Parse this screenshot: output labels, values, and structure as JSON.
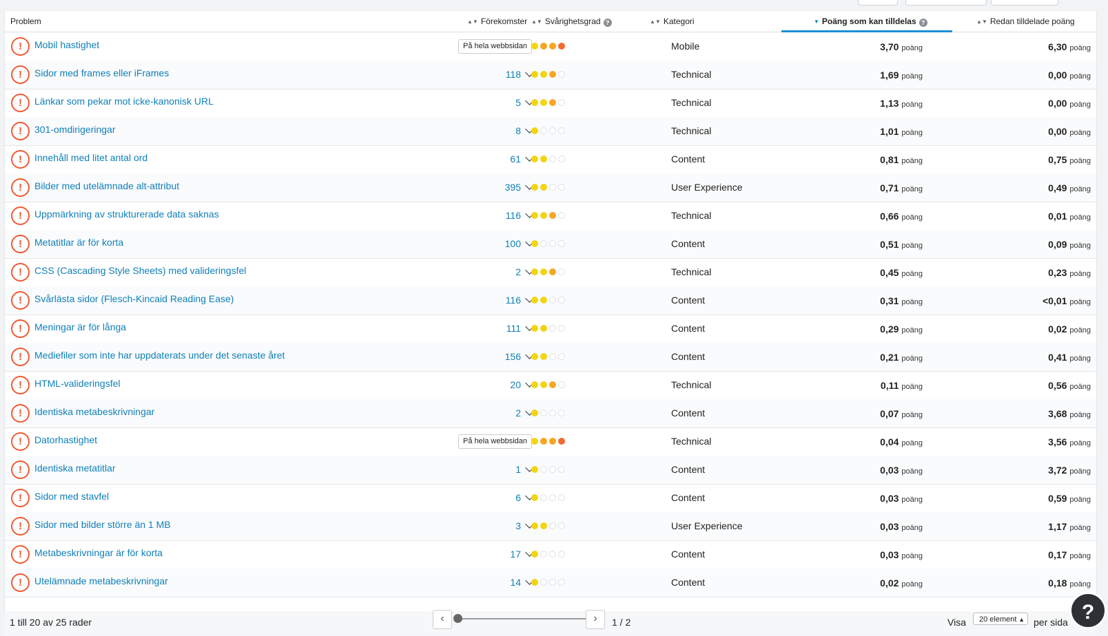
{
  "header": {
    "problem": "Problem",
    "occurrences": "Förekomster",
    "difficulty": "Svårighetsgrad",
    "category": "Kategori",
    "points": "Poäng som kan tilldelas",
    "awarded": "Redan tilldelade poäng",
    "help_glyph": "?"
  },
  "colors": {
    "link": "#0f7fb8",
    "error": "#f05a32",
    "dot_yellow": "#f2d413",
    "dot_amber": "#f6a623",
    "dot_orange": "#f26b2e",
    "dot_empty_border": "#dcdfe3",
    "accent": "#1a8fd6"
  },
  "icons": {
    "row": "exclamation-circle-icon",
    "expand": "chevron-down-icon",
    "sort": "sort-arrows-icon"
  },
  "unit": "poäng",
  "site_label": "På hela webbsidan",
  "rows": [
    {
      "name": "Mobil hastighet",
      "occ": "",
      "site": true,
      "dots": [
        1,
        2,
        2,
        3
      ],
      "cat": "Mobile",
      "pts": "3,70",
      "awarded": "6,30"
    },
    {
      "name": "Sidor med frames eller iFrames",
      "occ": "118",
      "site": false,
      "dots": [
        1,
        1,
        2,
        0
      ],
      "cat": "Technical",
      "pts": "1,69",
      "awarded": "0,00"
    },
    {
      "name": "Länkar som pekar mot icke-kanonisk URL",
      "occ": "5",
      "site": false,
      "dots": [
        1,
        1,
        2,
        0
      ],
      "cat": "Technical",
      "pts": "1,13",
      "awarded": "0,00"
    },
    {
      "name": "301-omdirigeringar",
      "occ": "8",
      "site": false,
      "dots": [
        1,
        0,
        0,
        0
      ],
      "cat": "Technical",
      "pts": "1,01",
      "awarded": "0,00"
    },
    {
      "name": "Innehåll med litet antal ord",
      "occ": "61",
      "site": false,
      "dots": [
        1,
        1,
        0,
        0
      ],
      "cat": "Content",
      "pts": "0,81",
      "awarded": "0,75"
    },
    {
      "name": "Bilder med utelämnade alt-attribut",
      "occ": "395",
      "site": false,
      "dots": [
        1,
        1,
        0,
        0
      ],
      "cat": "User Experience",
      "pts": "0,71",
      "awarded": "0,49"
    },
    {
      "name": "Uppmärkning av strukturerade data saknas",
      "occ": "116",
      "site": false,
      "dots": [
        1,
        1,
        2,
        0
      ],
      "cat": "Technical",
      "pts": "0,66",
      "awarded": "0,01"
    },
    {
      "name": "Metatitlar är för korta",
      "occ": "100",
      "site": false,
      "dots": [
        1,
        0,
        0,
        0
      ],
      "cat": "Content",
      "pts": "0,51",
      "awarded": "0,09"
    },
    {
      "name": "CSS (Cascading Style Sheets) med valideringsfel",
      "occ": "2",
      "site": false,
      "dots": [
        1,
        1,
        2,
        0
      ],
      "cat": "Technical",
      "pts": "0,45",
      "awarded": "0,23"
    },
    {
      "name": "Svårlästa sidor (Flesch-Kincaid Reading Ease)",
      "occ": "116",
      "site": false,
      "dots": [
        1,
        1,
        0,
        0
      ],
      "cat": "Content",
      "pts": "0,31",
      "awarded": "<0,01"
    },
    {
      "name": "Meningar är för långa",
      "occ": "111",
      "site": false,
      "dots": [
        1,
        1,
        0,
        0
      ],
      "cat": "Content",
      "pts": "0,29",
      "awarded": "0,02"
    },
    {
      "name": "Mediefiler som inte har uppdaterats under det senaste året",
      "occ": "156",
      "site": false,
      "dots": [
        1,
        1,
        0,
        0
      ],
      "cat": "Content",
      "pts": "0,21",
      "awarded": "0,41"
    },
    {
      "name": "HTML-valideringsfel",
      "occ": "20",
      "site": false,
      "dots": [
        1,
        1,
        2,
        0
      ],
      "cat": "Technical",
      "pts": "0,11",
      "awarded": "0,56"
    },
    {
      "name": "Identiska metabeskrivningar",
      "occ": "2",
      "site": false,
      "dots": [
        1,
        0,
        0,
        0
      ],
      "cat": "Content",
      "pts": "0,07",
      "awarded": "3,68"
    },
    {
      "name": "Datorhastighet",
      "occ": "",
      "site": true,
      "dots": [
        1,
        2,
        2,
        3
      ],
      "cat": "Technical",
      "pts": "0,04",
      "awarded": "3,56"
    },
    {
      "name": "Identiska metatitlar",
      "occ": "1",
      "site": false,
      "dots": [
        1,
        0,
        0,
        0
      ],
      "cat": "Content",
      "pts": "0,03",
      "awarded": "3,72"
    },
    {
      "name": "Sidor med stavfel",
      "occ": "6",
      "site": false,
      "dots": [
        1,
        0,
        0,
        0
      ],
      "cat": "Content",
      "pts": "0,03",
      "awarded": "0,59"
    },
    {
      "name": "Sidor med bilder större än 1 MB",
      "occ": "3",
      "site": false,
      "dots": [
        1,
        1,
        0,
        0
      ],
      "cat": "User Experience",
      "pts": "0,03",
      "awarded": "1,17"
    },
    {
      "name": "Metabeskrivningar är för korta",
      "occ": "17",
      "site": false,
      "dots": [
        1,
        0,
        0,
        0
      ],
      "cat": "Content",
      "pts": "0,03",
      "awarded": "0,17"
    },
    {
      "name": "Utelämnade metabeskrivningar",
      "occ": "14",
      "site": false,
      "dots": [
        1,
        0,
        0,
        0
      ],
      "cat": "Content",
      "pts": "0,02",
      "awarded": "0,18"
    }
  ],
  "footer": {
    "range": "1 till 20 av 25 rader",
    "page": "1 / 2",
    "show": "Visa",
    "per_page": "20 element",
    "per_page_suffix": "per sida",
    "prev_glyph": "‹",
    "next_glyph": "›"
  },
  "help_button": "?"
}
